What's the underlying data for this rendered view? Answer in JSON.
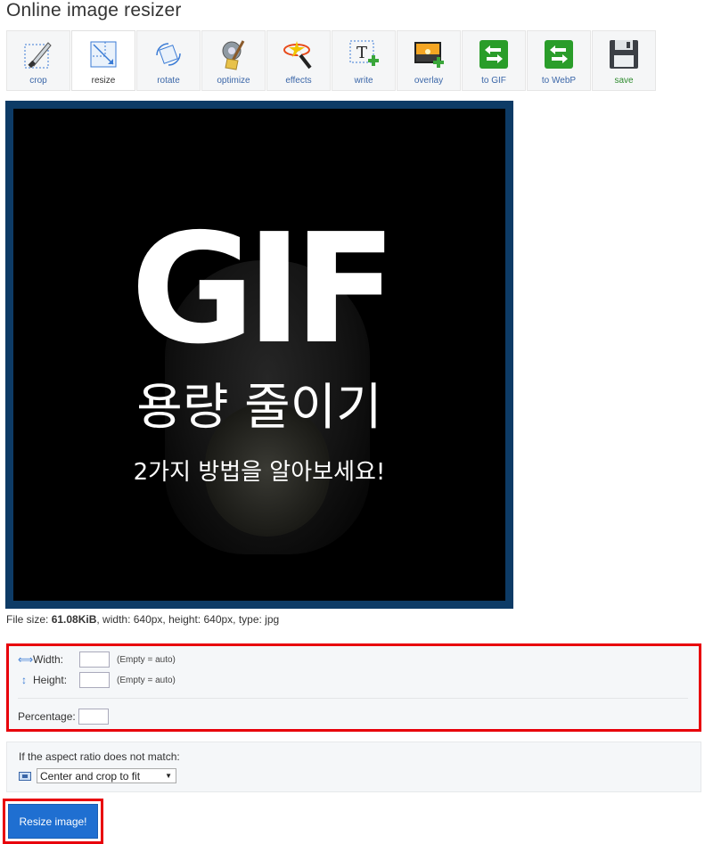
{
  "page": {
    "title": "Online image resizer"
  },
  "toolbar": {
    "tools": [
      {
        "id": "crop",
        "label": "crop",
        "icon": "crop-knife-icon",
        "active": false
      },
      {
        "id": "resize",
        "label": "resize",
        "icon": "resize-icon",
        "active": true
      },
      {
        "id": "rotate",
        "label": "rotate",
        "icon": "rotate-icon",
        "active": false
      },
      {
        "id": "optimize",
        "label": "optimize",
        "icon": "broom-icon",
        "active": false
      },
      {
        "id": "effects",
        "label": "effects",
        "icon": "magic-wand-icon",
        "active": false
      },
      {
        "id": "write",
        "label": "write",
        "icon": "text-tool-icon",
        "active": false
      },
      {
        "id": "overlay",
        "label": "overlay",
        "icon": "overlay-image-icon",
        "active": false
      },
      {
        "id": "to-gif",
        "label": "to GIF",
        "icon": "convert-arrows-icon",
        "active": false
      },
      {
        "id": "to-webp",
        "label": "to WebP",
        "icon": "convert-arrows-icon",
        "active": false
      },
      {
        "id": "save",
        "label": "save",
        "icon": "floppy-disk-icon",
        "active": false
      }
    ]
  },
  "preview": {
    "headline": "GIF",
    "line1": "용량 줄이기",
    "line2": "2가지 방법을 알아보세요!",
    "frame_color": "#0d3b66"
  },
  "file_info": {
    "prefix": "File size: ",
    "size": "61.08KiB",
    "rest": ", width: 640px, height: 640px, type: jpg"
  },
  "dimensions": {
    "width_label": "Width:",
    "width_value": "",
    "width_hint": "(Empty = auto)",
    "height_label": "Height:",
    "height_value": "",
    "height_hint": "(Empty = auto)",
    "percentage_label": "Percentage:",
    "percentage_value": ""
  },
  "aspect": {
    "title": "If the aspect ratio does not match:",
    "selected": "Center and crop to fit"
  },
  "actions": {
    "resize_label": "Resize image!"
  },
  "colors": {
    "highlight": "#e8000b",
    "button": "#1f6fd1",
    "link": "#3a66a8"
  }
}
